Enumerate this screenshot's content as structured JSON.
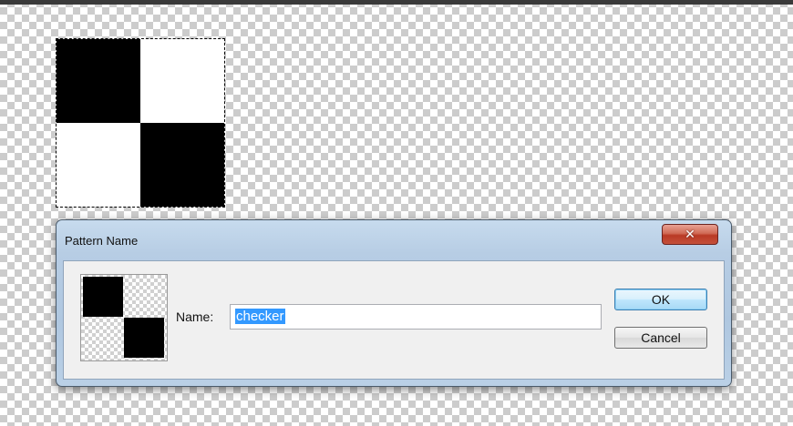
{
  "canvas": {
    "description_colors": {
      "black": "#000000",
      "white": "#ffffff",
      "transparency_grid": "#cccccc"
    }
  },
  "dialog": {
    "title": "Pattern Name",
    "close_icon": "close-icon",
    "name_label": "Name:",
    "name_value": "checker",
    "ok_label": "OK",
    "cancel_label": "Cancel",
    "colors": {
      "selection_highlight": "#3399ff",
      "close_button": "#c4503a",
      "ok_border": "#3c7fb1"
    }
  }
}
